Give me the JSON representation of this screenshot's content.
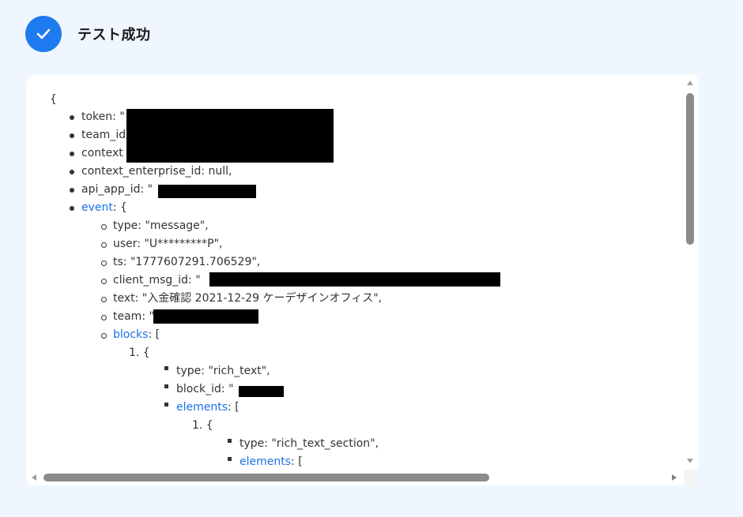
{
  "header": {
    "title": "テスト成功",
    "icon": "check-icon",
    "icon_color": "#1e7bef"
  },
  "json_view": {
    "open_brace": "{",
    "token": "token: \"",
    "team_id": "team_id",
    "context": "context",
    "context_enterprise_id": "context_enterprise_id: null,",
    "api_app_id": "api_app_id: \"",
    "event_key": "event",
    "event_suffix": ": {",
    "event": {
      "type": "type: \"message\",",
      "user": "user: \"U*********P\",",
      "ts": "ts: \"1777607291.706529\",",
      "client_msg_id": "client_msg_id: \"",
      "text": "text: \"入金確認 2021-12-29 ケーデザインオフィス\",",
      "team": "team: \"",
      "blocks_key": "blocks",
      "blocks_suffix": ": [",
      "block_1_index": "1. {",
      "block_1": {
        "type": "type: \"rich_text\",",
        "block_id": "block_id: \"",
        "elements_key": "elements",
        "elements_suffix": ": [",
        "element_1_index": "1. {",
        "element_1": {
          "type": "type: \"rich_text_section\",",
          "elements_key": "elements",
          "elements_suffix": ": ["
        }
      }
    }
  },
  "scrollbars": {
    "vertical": "vertical-scrollbar",
    "horizontal": "horizontal-scrollbar"
  }
}
